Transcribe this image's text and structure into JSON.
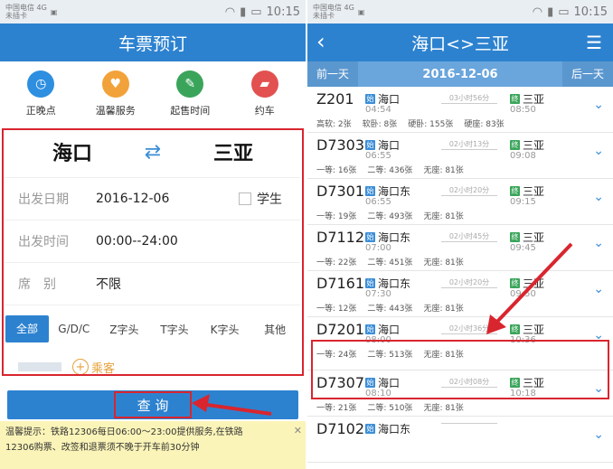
{
  "left": {
    "status": {
      "carrier_line1": "中国电信 4G",
      "carrier_line2": "未插卡",
      "time": "10:15"
    },
    "title": "车票预订",
    "shortcuts": [
      {
        "label": "正晚点",
        "color": "#2e8fe0",
        "icon": "clock-search-icon"
      },
      {
        "label": "温馨服务",
        "color": "#f2a23a",
        "icon": "service-icon"
      },
      {
        "label": "起售时间",
        "color": "#3aa55a",
        "icon": "ticket-time-icon"
      },
      {
        "label": "约车",
        "color": "#e35050",
        "icon": "car-icon"
      }
    ],
    "from_city": "海口",
    "to_city": "三亚",
    "swap_glyph": "⇄",
    "date_label": "出发日期",
    "date_value": "2016-12-06",
    "student_label": "学生",
    "time_label": "出发时间",
    "time_value": "00:00--24:00",
    "seat_label": "席　别",
    "seat_value": "不限",
    "train_types": [
      "全部",
      "G/D/C",
      "Z字头",
      "T字头",
      "K字头",
      "其他"
    ],
    "add_passenger": "乘客",
    "query_button": "查 询",
    "tips_line1": "温馨提示：铁路12306每日06:00～23:00提供服务,在铁路",
    "tips_line2": "12306购票、改签和退票须不晚于开车前30分钟",
    "tips_close": "✕"
  },
  "right": {
    "status": {
      "carrier_line1": "中国电信 4G",
      "carrier_line2": "未插卡",
      "time": "10:15"
    },
    "title": "海口<>三亚",
    "prev_day": "前一天",
    "date": "2016-12-06",
    "next_day": "后一天",
    "trains": [
      {
        "num": "Z201",
        "from_badge": "始",
        "from": "海口",
        "from_time": "04:54",
        "dur": "03小时56分",
        "to_badge": "终",
        "to": "三亚",
        "to_time": "08:50",
        "seats": [
          "高软: 2张",
          "软卧: 8张",
          "硬卧: 155张",
          "硬座: 83张"
        ]
      },
      {
        "num": "D7303",
        "from_badge": "始",
        "from": "海口",
        "from_time": "06:55",
        "dur": "02小时13分",
        "to_badge": "终",
        "to": "三亚",
        "to_time": "09:08",
        "seats": [
          "一等: 16张",
          "二等: 436张",
          "无座: 81张"
        ]
      },
      {
        "num": "D7301",
        "from_badge": "始",
        "from": "海口东",
        "from_time": "06:55",
        "dur": "02小时20分",
        "to_badge": "终",
        "to": "三亚",
        "to_time": "09:15",
        "seats": [
          "一等: 19张",
          "二等: 493张",
          "无座: 81张"
        ]
      },
      {
        "num": "D7112",
        "from_badge": "始",
        "from": "海口东",
        "from_time": "07:00",
        "dur": "02小时45分",
        "to_badge": "终",
        "to": "三亚",
        "to_time": "09:45",
        "seats": [
          "一等: 22张",
          "二等: 451张",
          "无座: 81张"
        ]
      },
      {
        "num": "D7161",
        "from_badge": "始",
        "from": "海口东",
        "from_time": "07:30",
        "dur": "02小时20分",
        "to_badge": "终",
        "to": "三亚",
        "to_time": "09:50",
        "seats": [
          "一等: 12张",
          "二等: 443张",
          "无座: 81张"
        ]
      },
      {
        "num": "D7201",
        "from_badge": "始",
        "from": "海口",
        "from_time": "08:00",
        "dur": "02小时36分",
        "to_badge": "终",
        "to": "三亚",
        "to_time": "10:36",
        "seats": [
          "一等: 24张",
          "二等: 513张",
          "无座: 81张"
        ]
      },
      {
        "num": "D7307",
        "from_badge": "始",
        "from": "海口",
        "from_time": "08:10",
        "dur": "02小时08分",
        "to_badge": "终",
        "to": "三亚",
        "to_time": "10:18",
        "seats": [
          "一等: 21张",
          "二等: 510张",
          "无座: 81张"
        ]
      },
      {
        "num": "D7102",
        "from_badge": "始",
        "from": "海口东",
        "from_time": "",
        "dur": "",
        "to_badge": "",
        "to": "",
        "to_time": "",
        "seats": []
      }
    ]
  },
  "colors": {
    "accent": "#2d82d0",
    "highlight": "#d9252e",
    "tips_bg": "#fbf4b8"
  }
}
